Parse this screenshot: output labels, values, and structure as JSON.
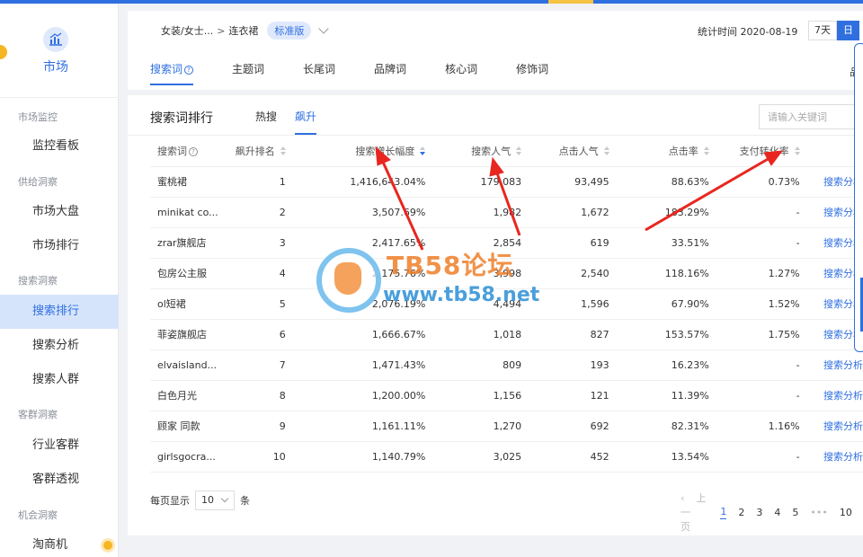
{
  "sidebar": {
    "brand": "市场",
    "sections": [
      {
        "title": "市场监控",
        "items": [
          "监控看板"
        ]
      },
      {
        "title": "供给洞察",
        "items": [
          "市场大盘",
          "市场排行"
        ]
      },
      {
        "title": "搜索洞察",
        "items": [
          "搜索排行",
          "搜索分析",
          "搜索人群"
        ]
      },
      {
        "title": "客群洞察",
        "items": [
          "行业客群",
          "客群透视"
        ]
      },
      {
        "title": "机会洞察",
        "items": [
          "淘商机"
        ]
      }
    ],
    "active_item": "搜索排行"
  },
  "header": {
    "breadcrumb": {
      "category": "女装/女士...",
      "separator": ">",
      "leaf": "连衣裙",
      "tag": "标准版"
    },
    "stat_time": "统计时间 2020-08-19",
    "range_buttons": [
      {
        "label": "7天"
      },
      {
        "label": "日"
      }
    ],
    "tabs": [
      {
        "label": "搜索词",
        "help": "?"
      },
      {
        "label": "主题词"
      },
      {
        "label": "长尾词"
      },
      {
        "label": "品牌词"
      },
      {
        "label": "核心词"
      },
      {
        "label": "修饰词"
      }
    ],
    "cut_text": "品"
  },
  "main": {
    "title": "搜索词排行",
    "subtabs": [
      "热搜",
      "飙升"
    ],
    "search_placeholder": "请输入关键词",
    "columns": {
      "word": "搜索词",
      "help": "?",
      "rank": "飙升排名",
      "growth": "搜索增长幅度",
      "search": "搜索人气",
      "click": "点击人气",
      "ctr": "点击率",
      "pay": "支付转化率"
    },
    "rows": [
      {
        "word": "蜜桃裙",
        "rank": "1",
        "growth": "1,416,643.04%",
        "search": "179,083",
        "click": "93,495",
        "ctr": "88.63%",
        "pay": "0.73%",
        "op": "搜索分析"
      },
      {
        "word": "minikat co...",
        "rank": "2",
        "growth": "3,507.69%",
        "search": "1,982",
        "click": "1,672",
        "ctr": "183.29%",
        "pay": "-",
        "op": "搜索分析"
      },
      {
        "word": "zrar旗舰店",
        "rank": "3",
        "growth": "2,417.65%",
        "search": "2,854",
        "click": "619",
        "ctr": "33.51%",
        "pay": "-",
        "op": "搜索分析"
      },
      {
        "word": "包房公主服",
        "rank": "4",
        "growth": "2,175.76%",
        "search": "3,998",
        "click": "2,540",
        "ctr": "118.16%",
        "pay": "1.27%",
        "op": "搜索分析"
      },
      {
        "word": "ol短裙",
        "rank": "5",
        "growth": "2,076.19%",
        "search": "4,494",
        "click": "1,596",
        "ctr": "67.90%",
        "pay": "1.52%",
        "op": "搜索分析"
      },
      {
        "word": "菲姿旗舰店",
        "rank": "6",
        "growth": "1,666.67%",
        "search": "1,018",
        "click": "827",
        "ctr": "153.57%",
        "pay": "1.75%",
        "op": "搜索分析"
      },
      {
        "word": "elvaisland...",
        "rank": "7",
        "growth": "1,471.43%",
        "search": "809",
        "click": "193",
        "ctr": "16.23%",
        "pay": "-",
        "op": "搜索分析"
      },
      {
        "word": "白色月光",
        "rank": "8",
        "growth": "1,200.00%",
        "search": "1,156",
        "click": "121",
        "ctr": "11.39%",
        "pay": "-",
        "op": "搜索分析"
      },
      {
        "word": "顾家 同款",
        "rank": "9",
        "growth": "1,161.11%",
        "search": "1,270",
        "click": "692",
        "ctr": "82.31%",
        "pay": "1.16%",
        "op": "搜索分析"
      },
      {
        "word": "girlsgocra...",
        "rank": "10",
        "growth": "1,140.79%",
        "search": "3,025",
        "click": "452",
        "ctr": "13.54%",
        "pay": "-",
        "op": "搜索分析"
      }
    ],
    "pagination": {
      "per_page_label": "每页显示",
      "per_page_value": "10",
      "per_page_unit": "条",
      "prev": "上一页",
      "pages": [
        "1",
        "2",
        "3",
        "4",
        "5"
      ],
      "dots": "•••",
      "last": "10"
    }
  },
  "watermark": {
    "line1": "TB58论坛",
    "line2": "www.tb58.net"
  },
  "colors": {
    "accent": "#2f6fe0",
    "arrow": "#e8261f",
    "badge": "#f6b623"
  }
}
